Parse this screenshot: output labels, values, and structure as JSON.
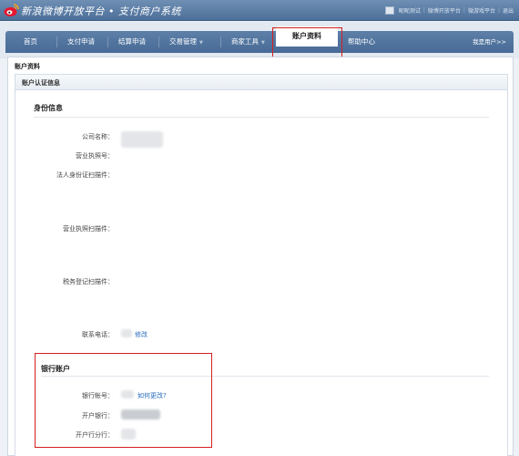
{
  "header": {
    "app_title": "新浪微博开放平台 • 支付商户系统",
    "account_name": "昵昵测试",
    "links": [
      "微博开放平台",
      "微游戏平台",
      "退出"
    ],
    "separators": [
      "|",
      "|",
      "|"
    ]
  },
  "nav": {
    "items": [
      "首页",
      "支付申请",
      "结算申请",
      "交易管理",
      "商家工具"
    ],
    "active": "账户资料",
    "help": "帮助中心",
    "user": "我是用户>>",
    "dropdown_caret": "▼"
  },
  "breadcrumb": "账户资料",
  "panel_title": "账户认证信息",
  "identity": {
    "title": "身份信息",
    "labels": {
      "company": "公司名称：",
      "license_no": "营业执照号：",
      "legal_id_scan": "法人身份证扫描件：",
      "license_scan": "营业执照扫描件：",
      "tax_scan": "税务登记扫描件：",
      "phone": "联系电话："
    },
    "phone_modify": "修改"
  },
  "bank": {
    "title": "银行账户",
    "labels": {
      "account_no": "银行帐号：",
      "bank": "开户银行：",
      "branch": "开户行分行："
    },
    "how_to_change": "如何更改?"
  }
}
